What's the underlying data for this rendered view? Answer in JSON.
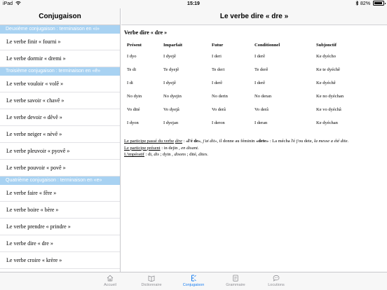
{
  "status_bar": {
    "device": "iPad",
    "time": "15:19",
    "battery": "82%"
  },
  "sidebar": {
    "title": "Conjugaison",
    "sections": [
      {
        "header": "Deuxième conjugaison : terminaison en «i»",
        "items": [
          "Le verbe finir « fourni »",
          "Le verbe dormir « dremi »"
        ]
      },
      {
        "header": "Troisième conjugaison : terminaison en «ê»",
        "items": [
          "Le verbe vouloir « volê »",
          "Le verbe savoir « chavê »",
          "Le verbe devoir « dêvê »",
          "Le verbe neiger « nèvê »",
          "Le verbe pleuvoir « pyovê »",
          "Le verbe pouvoir « povê »"
        ]
      },
      {
        "header": "Quatrième conjugaison : terminaison en «e»",
        "items": [
          "Le verbe faire « fêre »",
          "Le verbe boire « bère »",
          "Le verbe prendre « prindre »",
          "Le verbe dire « dre »",
          "Le verbe croire « krère »"
        ]
      }
    ]
  },
  "main": {
    "title": "Le verbe dire « dre »",
    "content_title": "Verbe dire « dre »",
    "table": {
      "headers": [
        "Présent",
        "Imparfait",
        "Futur",
        "Conditionnel",
        "Subjonctif"
      ],
      "rows": [
        [
          "I dyo",
          "I dyejê",
          "I deri",
          "I derê",
          "Ke dyécho"
        ],
        [
          "Te di",
          "Te dyejê",
          "Te deri",
          "Te derê",
          "Ke te dyéchê"
        ],
        [
          "I di",
          "I dyejê",
          "I derê",
          "I derê",
          "Ke dyéchê"
        ],
        [
          "No dyin",
          "No dyejin",
          "No derin",
          "No deran",
          "Ke no dyéchan"
        ],
        [
          "Vo dité",
          "Vo dyejâ",
          "Vo derâ",
          "Vo derâ",
          "Ke vo dyéchâ"
        ],
        [
          "I dyon",
          "I dyejan",
          "I deron",
          "I deran",
          "Ke dyéchan"
        ]
      ]
    },
    "notes": {
      "participe_passe_label": "Le participe passé du verbe",
      "participe_passe_verb": "dire",
      "participe_passe_sep": " : ",
      "participe_passe_form": "«l'é de»",
      "participe_passe_example1": ", j'ai dit»",
      "participe_passe_mid": ", il donne au féminin ",
      "participe_passe_fem": "«dete»",
      "participe_passe_end": " : La mécha l'é j'ou dete, ",
      "participe_passe_example2": "la messe a été dite.",
      "participe_present_label": "Le participe présent",
      "participe_present_text": " : in dejin , ",
      "participe_present_example": "en disant.",
      "imperatif_label": "L'impératif",
      "imperatif_text1": " : di, ",
      "imperatif_ex1": "dis",
      "imperatif_text2": " ; dyin , ",
      "imperatif_ex2": "disons",
      "imperatif_text3": " ; dité, ",
      "imperatif_ex3": "dites."
    }
  },
  "tabbar": {
    "items": [
      {
        "label": "Accueil",
        "icon": "home-icon",
        "active": false
      },
      {
        "label": "Dictionnaire",
        "icon": "book-icon",
        "active": false
      },
      {
        "label": "Conjugaison",
        "icon": "conjugation-icon",
        "active": true
      },
      {
        "label": "Grammaire",
        "icon": "grammar-book-icon",
        "active": false
      },
      {
        "label": "Locutions",
        "icon": "speech-bubble-icon",
        "active": false
      }
    ],
    "active_color": "#1a7ff2",
    "inactive_color": "#8e8e93"
  }
}
